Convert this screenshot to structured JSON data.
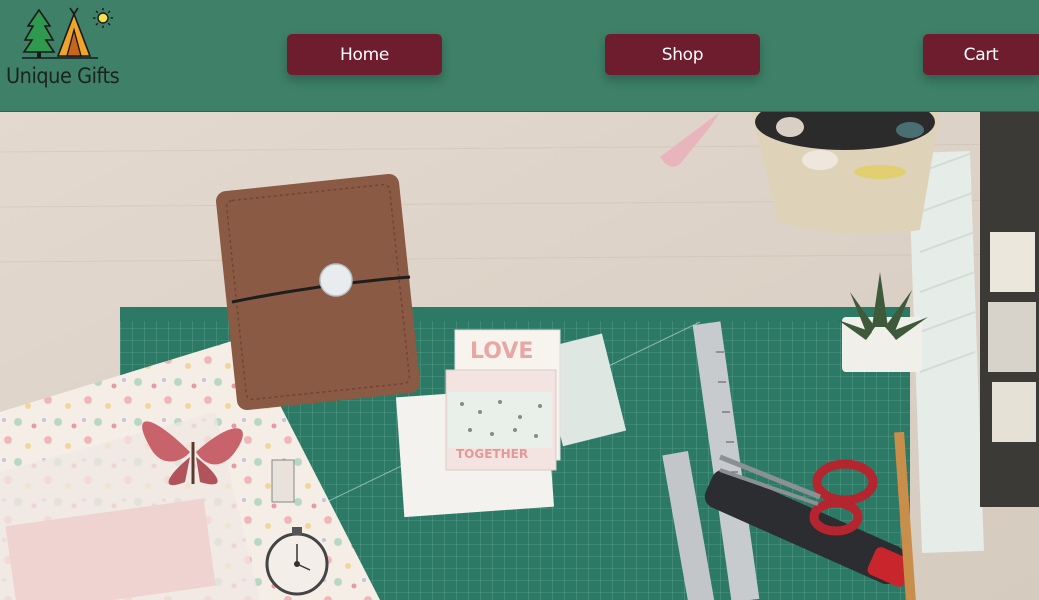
{
  "brand": {
    "name": "Unique Gifts",
    "icons": [
      "tree-icon",
      "tent-icon",
      "sun-icon"
    ]
  },
  "nav": {
    "home_label": "Home",
    "shop_label": "Shop",
    "cart_label": "Cart"
  },
  "hero": {
    "sticker_love": "LOVE",
    "sticker_together": "TOGETHER"
  },
  "colors": {
    "header_bg": "#3e8068",
    "button_bg": "#6e1d2f",
    "button_text": "#ffffff",
    "cutting_mat": "#2c7a66"
  }
}
